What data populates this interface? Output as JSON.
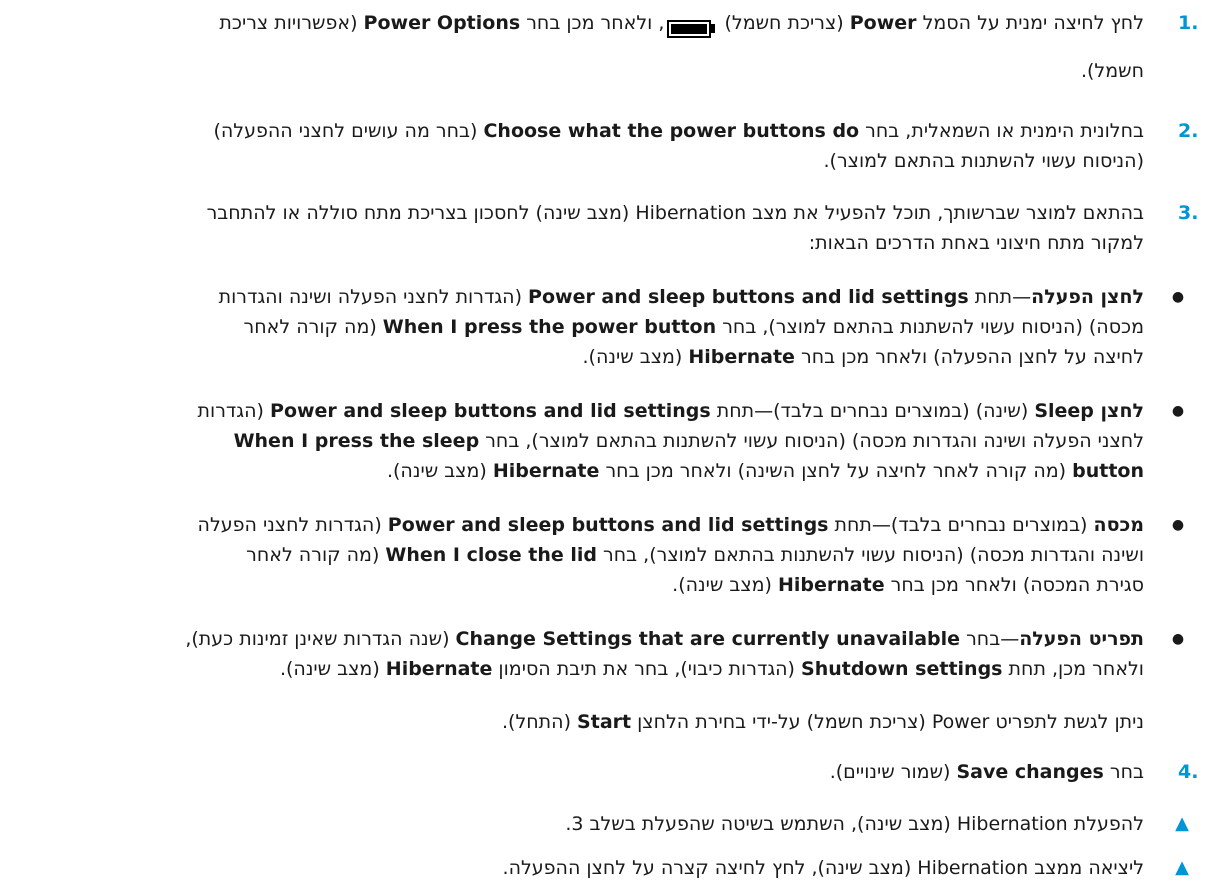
{
  "steps": [
    {
      "number": ".1",
      "lines": [
        [
          {
            "t": "לחץ לחיצה ימנית על הסמל "
          },
          {
            "t": "Power",
            "b": true
          },
          {
            "t": " (צריכת חשמל) "
          },
          {
            "icon": "battery-icon"
          },
          {
            "t": ", ולאחר מכן בחר "
          },
          {
            "t": "Power Options",
            "b": true
          },
          {
            "t": " (אפשרויות צריכת"
          }
        ],
        [
          {
            "t": "חשמל)."
          }
        ]
      ]
    },
    {
      "number": ".2",
      "lines": [
        [
          {
            "t": "בחלונית הימנית או השמאלית, בחר "
          },
          {
            "t": "Choose what the power buttons do",
            "b": true
          },
          {
            "t": " (בחר מה עושים לחצני ההפעלה)"
          }
        ],
        [
          {
            "t": "(הניסוח עשוי להשתנות בהתאם למוצר)."
          }
        ]
      ]
    },
    {
      "number": ".3",
      "lines": [
        [
          {
            "t": "בהתאם למוצר שברשותך, תוכל להפעיל את מצב Hibernation (מצב שינה) לחסכון בצריכת מתח סוללה או להתחבר"
          }
        ],
        [
          {
            "t": "למקור מתח חיצוני באחת הדרכים הבאות:"
          }
        ]
      ]
    }
  ],
  "bullets": [
    {
      "lines": [
        [
          {
            "t": "לחצן הפעלה",
            "b": true
          },
          {
            "t": "—תחת "
          },
          {
            "t": "Power and sleep buttons and lid settings",
            "b": true
          },
          {
            "t": " (הגדרות לחצני הפעלה ושינה והגדרות"
          }
        ],
        [
          {
            "t": "מכסה) (הניסוח עשוי להשתנות בהתאם למוצר), בחר "
          },
          {
            "t": "When I press the power button",
            "b": true
          },
          {
            "t": " (מה קורה לאחר"
          }
        ],
        [
          {
            "t": "לחיצה על לחצן ההפעלה) ולאחר מכן בחר "
          },
          {
            "t": "Hibernate",
            "b": true
          },
          {
            "t": " (מצב שינה)."
          }
        ]
      ]
    },
    {
      "lines": [
        [
          {
            "t": "לחצן ",
            "b": true
          },
          {
            "t": "Sleep",
            "b": true
          },
          {
            "t": " (שינה) (במוצרים נבחרים בלבד)—תחת "
          },
          {
            "t": "Power and sleep buttons and lid settings",
            "b": true
          },
          {
            "t": " (הגדרות"
          }
        ],
        [
          {
            "t": "לחצני הפעלה ושינה והגדרות מכסה) (הניסוח עשוי להשתנות בהתאם למוצר), בחר "
          },
          {
            "t": "When I press the sleep",
            "b": true
          }
        ],
        [
          {
            "t": "button",
            "b": true
          },
          {
            "t": " (מה קורה לאחר לחיצה על לחצן השינה) ולאחר מכן בחר "
          },
          {
            "t": "Hibernate",
            "b": true
          },
          {
            "t": " (מצב שינה)."
          }
        ]
      ]
    },
    {
      "lines": [
        [
          {
            "t": "מכסה",
            "b": true
          },
          {
            "t": " (במוצרים נבחרים בלבד)—תחת "
          },
          {
            "t": "Power and sleep buttons and lid settings",
            "b": true
          },
          {
            "t": " (הגדרות לחצני הפעלה"
          }
        ],
        [
          {
            "t": "ושינה והגדרות מכסה) (הניסוח עשוי להשתנות בהתאם למוצר), בחר "
          },
          {
            "t": "When I close the lid",
            "b": true
          },
          {
            "t": " (מה קורה לאחר"
          }
        ],
        [
          {
            "t": "סגירת המכסה) ולאחר מכן בחר "
          },
          {
            "t": "Hibernate",
            "b": true
          },
          {
            "t": " (מצב שינה)."
          }
        ]
      ]
    },
    {
      "lines": [
        [
          {
            "t": "תפריט הפעלה",
            "b": true
          },
          {
            "t": "—בחר "
          },
          {
            "t": "Change Settings that are currently unavailable",
            "b": true
          },
          {
            "t": " (שנה הגדרות שאינן זמינות כעת),"
          }
        ],
        [
          {
            "t": "ולאחר מכן, תחת "
          },
          {
            "t": "Shutdown settings",
            "b": true
          },
          {
            "t": " (הגדרות כיבוי), בחר את תיבת הסימון "
          },
          {
            "t": "Hibernate",
            "b": true
          },
          {
            "t": " (מצב שינה)."
          }
        ]
      ]
    }
  ],
  "note": [
    {
      "t": "ניתן לגשת לתפריט Power (צריכת חשמל) על-ידי בחירת הלחצן "
    },
    {
      "t": "Start",
      "b": true
    },
    {
      "t": " (התחל)."
    }
  ],
  "step4": {
    "number": ".4",
    "lines": [
      [
        {
          "t": "בחר "
        },
        {
          "t": "Save changes",
          "b": true
        },
        {
          "t": " (שמור שינויים)."
        }
      ]
    ]
  },
  "tips": [
    [
      {
        "t": "להפעלת Hibernation (מצב שינה), השתמש בשיטה שהפעלת בשלב 3."
      }
    ],
    [
      {
        "t": "ליציאה ממצב Hibernation (מצב שינה), לחץ לחיצה קצרה על לחצן ההפעלה."
      }
    ]
  ],
  "icons": {
    "bullet": "●",
    "tip": "▲"
  },
  "colors": {
    "accent": "#0096d6",
    "text": "#1a1a1a"
  }
}
